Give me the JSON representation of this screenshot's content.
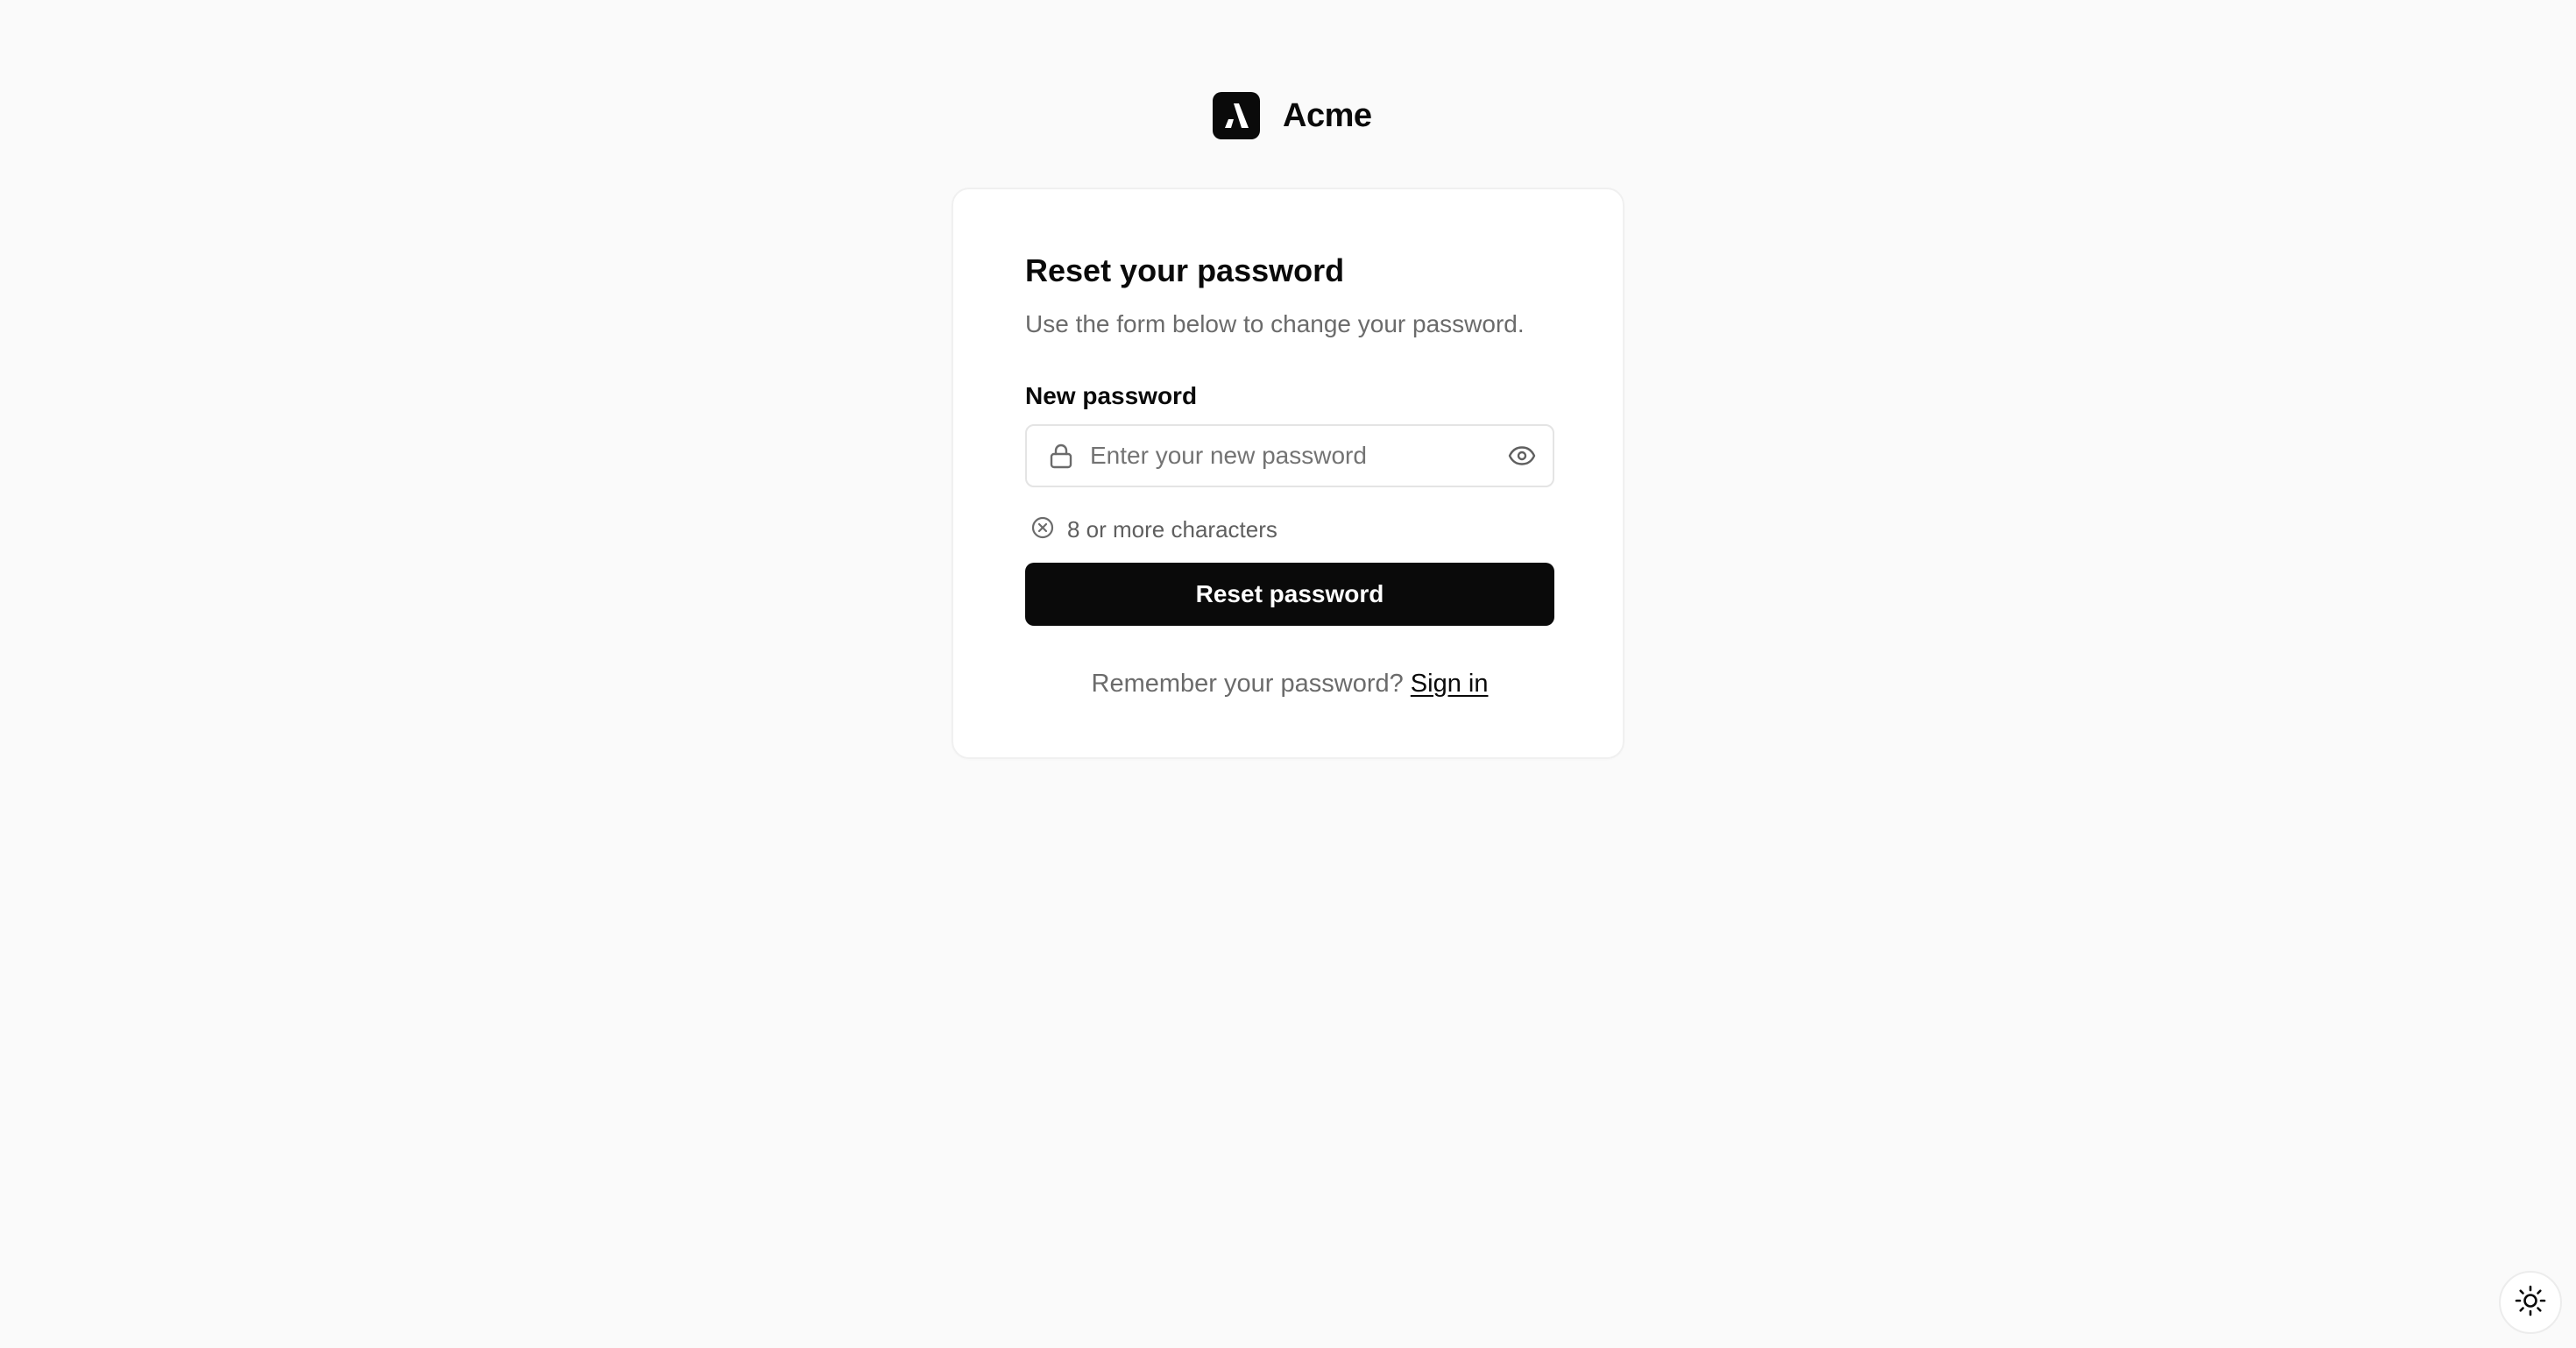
{
  "brand": {
    "name": "Acme",
    "logo_icon": "acme-logo-icon"
  },
  "card": {
    "title": "Reset your password",
    "subtitle": "Use the form below to change your password."
  },
  "form": {
    "password_label": "New password",
    "password_placeholder": "Enter your new password",
    "password_value": "",
    "lock_icon": "lock-icon",
    "visibility_icon": "eye-icon",
    "requirements": [
      {
        "icon": "x-circle-icon",
        "text": "8 or more characters",
        "met": false
      }
    ],
    "submit_label": "Reset password"
  },
  "footer": {
    "prompt": "Remember your password?",
    "link_label": "Sign in"
  },
  "theme_toggle": {
    "icon": "sun-icon"
  },
  "colors": {
    "background": "#fafafa",
    "card": "#ffffff",
    "primary": "#0a0a0a",
    "muted_text": "#6b6b6b"
  }
}
